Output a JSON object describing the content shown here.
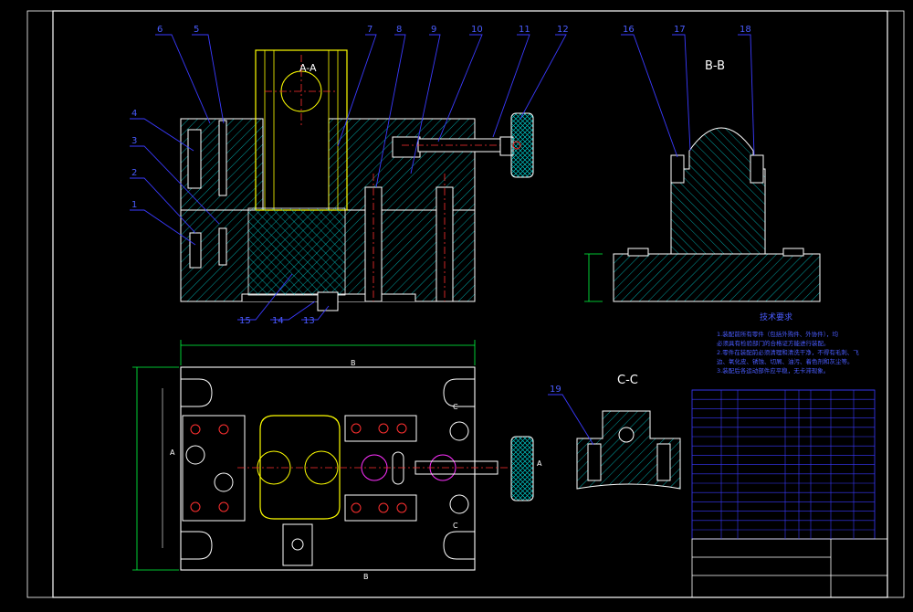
{
  "drawing": {
    "colors": {
      "background": "#000000",
      "outline": "#ffffff",
      "hatch": "#00c8c8",
      "leader": "#3a3aff",
      "centerline": "#ff3030",
      "dimension": "#00ff40",
      "body": "#ffff00",
      "text": "#4a5cff",
      "knob": "#ff2020",
      "magenta": "#ff30ff"
    },
    "balloons": [
      "6",
      "5",
      "7",
      "8",
      "9",
      "10",
      "11",
      "12",
      "4",
      "3",
      "2",
      "1",
      "15",
      "14",
      "13",
      "16",
      "17",
      "18",
      "19"
    ],
    "section_labels": {
      "a_a": "A-A",
      "b_b": "B-B",
      "c_c": "C-C"
    },
    "view_marks": {
      "a": "A",
      "b": "B",
      "c": "C"
    },
    "tech_req_title": "技术要求",
    "tech_requirements": [
      "1.装配前所有零件（包括外购件、外协件），均",
      "必须具有检验部门的合格证方能进行装配。",
      "2.零件在装配前必须清理和清洗干净，不得有毛刺、飞",
      "边、氧化皮、锈蚀、切屑、油污、着色剂和灰尘等。",
      "3.装配后各运动部件应平稳，无卡滞现象。"
    ]
  }
}
